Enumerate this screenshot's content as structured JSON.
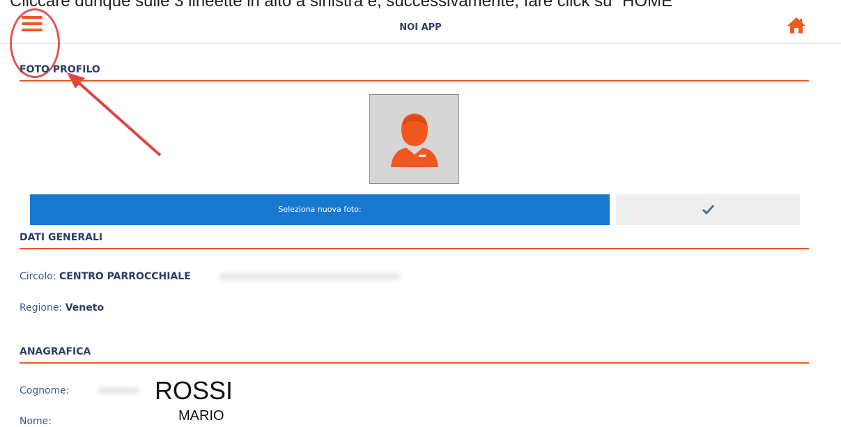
{
  "caption": "Cliccare dunque sulle 3 lineette in alto a sinistra e, successivamente, fare click su “HOME”",
  "header": {
    "title": "NOI APP"
  },
  "colors": {
    "accent": "#f0581e",
    "primary_button": "#1979d0",
    "heading": "#2a3e6a",
    "annotation": "#e04343"
  },
  "sections": {
    "photo": "FOTO PROFILO",
    "general": "DATI GENERALI",
    "registry": "ANAGRAFICA"
  },
  "photo": {
    "select_label": "Seleziona nuova foto:",
    "confirm_icon": "checkmark-icon"
  },
  "general": {
    "circolo_label": "Circolo:",
    "circolo_value": "CENTRO PARROCCHIALE",
    "regione_label": "Regione:",
    "regione_value": "Veneto"
  },
  "registry": {
    "cognome_label": "Cognome:",
    "cognome_value": "ROSSI",
    "nome_label": "Nome:",
    "nome_value": "MARIO"
  },
  "icons": {
    "menu": "hamburger-menu-icon",
    "home": "home-icon",
    "avatar": "user-avatar-icon"
  }
}
